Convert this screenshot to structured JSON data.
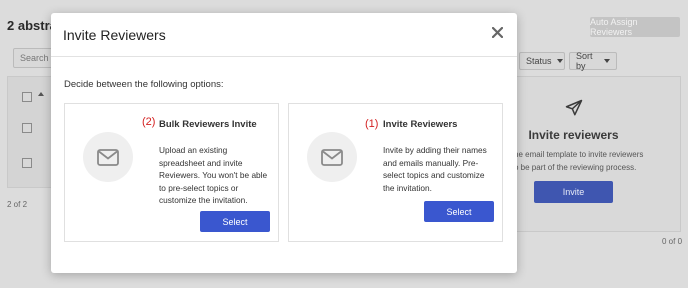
{
  "background": {
    "title": "2 abstrac",
    "auto_assign_label": "Auto Assign Reviewers",
    "search_placeholder": "Search",
    "left_count": "2 of 2",
    "status_label": "Status",
    "sort_label": "Sort by",
    "invite_title": "Invite reviewers",
    "invite_desc_line1": "he email template to invite reviewers",
    "invite_desc_line2": "o be part of the reviewing process.",
    "invite_button": "Invite",
    "right_count": "0 of 0"
  },
  "modal": {
    "title": "Invite Reviewers",
    "close_icon": "close-icon",
    "intro": "Decide between the following options:",
    "options": [
      {
        "number": "(2)",
        "title": "Bulk Reviewers Invite",
        "desc_lines": [
          "Upload an existing",
          "spreadsheet and invite",
          "Reviewers. You won't be able",
          "to pre-select topics or",
          "customize the invitation."
        ],
        "button": "Select",
        "icon": "envelope-icon"
      },
      {
        "number": "(1)",
        "title": "Invite Reviewers",
        "desc_lines": [
          "Invite by adding their names",
          "and emails manually. Pre-",
          "select topics and customize",
          "the invitation."
        ],
        "button": "Select",
        "icon": "envelope-icon"
      }
    ]
  },
  "colors": {
    "accent": "#3a57cf",
    "number_red": "#d32020",
    "overlay": "#dcdcdc"
  }
}
